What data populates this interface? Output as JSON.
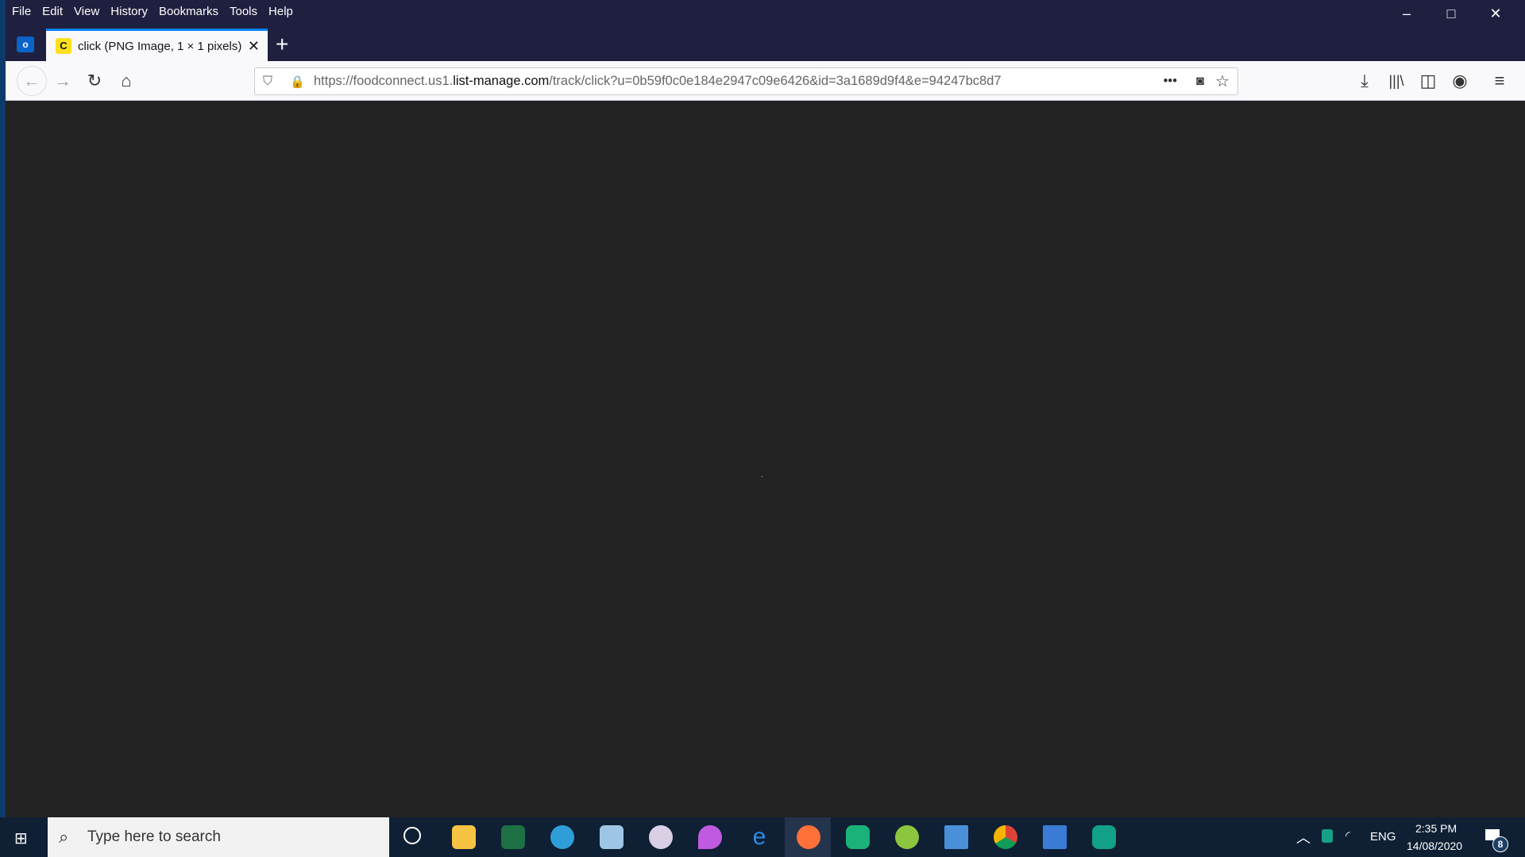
{
  "menu": [
    "File",
    "Edit",
    "View",
    "History",
    "Bookmarks",
    "Tools",
    "Help"
  ],
  "tab": {
    "title": "click (PNG Image, 1 × 1 pixels)"
  },
  "url": {
    "prefix": "https://foodconnect.us1.",
    "domain": "list-manage.com",
    "path": "/track/click?u=0b59f0c0e184e2947c09e6426&id=3a1689d9f4&e=94247bc8d7"
  },
  "taskbar": {
    "search_placeholder": "Type here to search",
    "icons": [
      "cortana",
      "file-explorer",
      "excel",
      "edge",
      "notes",
      "paint",
      "color-drop",
      "internet-explorer",
      "firefox",
      "maps",
      "app-green",
      "outlook-news",
      "chrome",
      "photos",
      "app-teal"
    ]
  },
  "tray": {
    "lang": "ENG",
    "time": "2:35 PM",
    "date": "14/08/2020",
    "notifications": "8"
  }
}
